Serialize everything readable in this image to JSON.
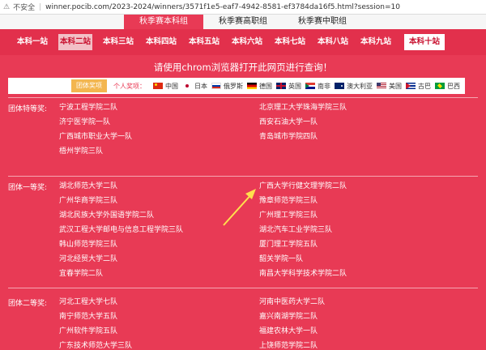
{
  "browser": {
    "security": "不安全",
    "url": "winner.pocib.com/2023-2024/winners/3571f1e5-eaf7-4942-8581-ef3784da16f5.html?session=10"
  },
  "top_tabs": [
    {
      "label": "秋季赛本科组",
      "active": true
    },
    {
      "label": "秋季赛高职组",
      "active": false
    },
    {
      "label": "秋季赛中职组",
      "active": false
    }
  ],
  "stations": [
    "本科一站",
    "本科二站",
    "本科三站",
    "本科四站",
    "本科五站",
    "本科六站",
    "本科七站",
    "本科八站",
    "本科九站",
    "本科十站"
  ],
  "notice": "请使用chrom浏览器打开此网页进行查询！",
  "filter": {
    "group_button": "团体奖项",
    "personal_label": "个人奖项：",
    "countries": [
      "中国",
      "日本",
      "俄罗斯",
      "德国",
      "英国",
      "南非",
      "澳大利亚",
      "美国",
      "古巴",
      "巴西"
    ]
  },
  "awards": {
    "special": {
      "label": "团体特等奖:",
      "left": [
        "宁波工程学院二队",
        "济宁医学院一队",
        "广西城市职业大学一队",
        "梧州学院三队"
      ],
      "right": [
        "北京理工大学珠海学院三队",
        "西安石油大学一队",
        "青岛城市学院四队"
      ]
    },
    "first": {
      "label": "团体一等奖:",
      "left": [
        "湖北师范大学二队",
        "广州华商学院三队",
        "湖北民族大学外国语学院二队",
        "武汉工程大学邮电与信息工程学院三队",
        "韩山师范学院三队",
        "河北经贸大学二队",
        "宜春学院二队"
      ],
      "right": [
        "广西大学行健文理学院二队",
        "豫章师范学院三队",
        "广州理工学院三队",
        "湖北汽车工业学院三队",
        "厦门理工学院五队",
        "韶关学院一队",
        "南昌大学科学技术学院二队"
      ]
    },
    "second": {
      "label": "团体二等奖:",
      "left": [
        "河北工程大学七队",
        "南宁师范大学五队",
        "广州软件学院五队",
        "广东技术师范大学三队"
      ],
      "right": [
        "河南中医药大学二队",
        "嘉兴南湖学院二队",
        "福建农林大学一队",
        "上饶师范学院二队"
      ]
    }
  }
}
